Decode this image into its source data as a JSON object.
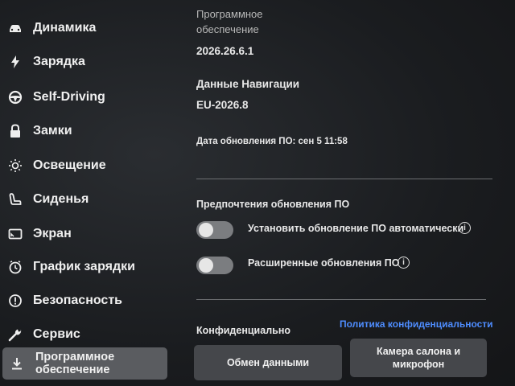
{
  "sidebar": {
    "items": [
      {
        "label": "Динамика",
        "icon": "car-icon"
      },
      {
        "label": "Зарядка",
        "icon": "lightning-icon"
      },
      {
        "label": "Self-Driving",
        "icon": "steering-wheel-icon"
      },
      {
        "label": "Замки",
        "icon": "lock-icon"
      },
      {
        "label": "Освещение",
        "icon": "sun-icon"
      },
      {
        "label": "Сиденья",
        "icon": "seat-icon"
      },
      {
        "label": "Экран",
        "icon": "display-icon"
      },
      {
        "label": "График зарядки",
        "icon": "clock-icon"
      },
      {
        "label": "Безопасность",
        "icon": "warning-icon"
      },
      {
        "label": "Сервис",
        "icon": "wrench-icon"
      },
      {
        "label": "Программное обеспечение",
        "icon": "download-icon"
      }
    ]
  },
  "software": {
    "section_label": "Программное обеспечение",
    "version": "2026.26.6.1",
    "nav_data_label": "Данные Навигации",
    "nav_data_version": "EU-2026.8",
    "update_date": "Дата обновления ПО: сен 5 11:58"
  },
  "update_prefs": {
    "title": "Предпочтения обновления ПО",
    "auto_update_label": "Установить обновление ПО автоматически",
    "auto_update_on": false,
    "advanced_label": "Расширенные обновления ПО",
    "advanced_on": false
  },
  "privacy": {
    "title": "Конфиденциально",
    "policy_link": "Политика конфиденциальности",
    "data_sharing_button": "Обмен данными",
    "camera_button": "Камера салона и микрофон"
  },
  "colors": {
    "accent_link": "#4e8dff"
  }
}
